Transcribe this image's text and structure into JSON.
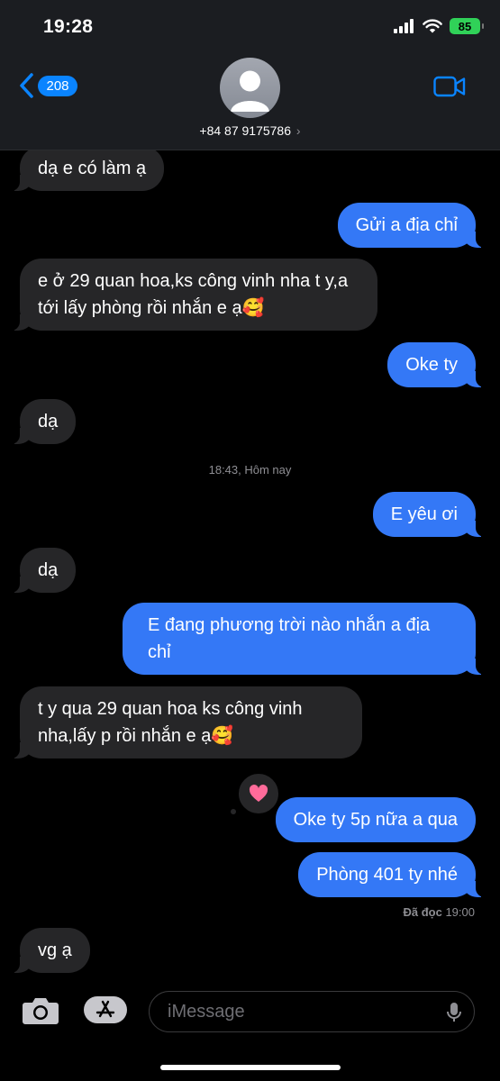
{
  "status_bar": {
    "time": "19:28",
    "battery": "85"
  },
  "header": {
    "back_count": "208",
    "contact": "+84 87 9175786",
    "chevron": "›"
  },
  "messages": [
    {
      "dir": "in",
      "text": "dạ e có làm ạ"
    },
    {
      "dir": "out",
      "text": "Gửi a địa chỉ"
    },
    {
      "dir": "in",
      "text": "e ở 29 quan hoa,ks công vinh nha t y,a tới lấy phòng rồi nhắn e ạ🥰"
    },
    {
      "dir": "out",
      "text": "Oke ty"
    },
    {
      "dir": "in",
      "text": "dạ"
    },
    {
      "dir": "out",
      "text": "E yêu ơi"
    },
    {
      "dir": "in",
      "text": "dạ"
    },
    {
      "dir": "out",
      "text": "E đang phương trời nào nhắn a địa chỉ"
    },
    {
      "dir": "in",
      "text": "t y qua 29 quan hoa ks công vinh nha,lấy p rồi nhắn e ạ🥰"
    },
    {
      "dir": "out",
      "text": "Oke ty 5p nữa a qua"
    },
    {
      "dir": "out",
      "text": "Phòng 401 ty nhé"
    },
    {
      "dir": "in",
      "text": "vg ạ"
    }
  ],
  "timestamp": "18:43, Hôm nay",
  "read_receipt": {
    "label": "Đã đọc",
    "time": "19:00"
  },
  "tapback": "heart",
  "input": {
    "placeholder": "iMessage"
  },
  "colors": {
    "outgoing": "#3478f6",
    "incoming": "#262628",
    "tapback_heart": "#ff6b9a",
    "battery": "#30d158"
  }
}
